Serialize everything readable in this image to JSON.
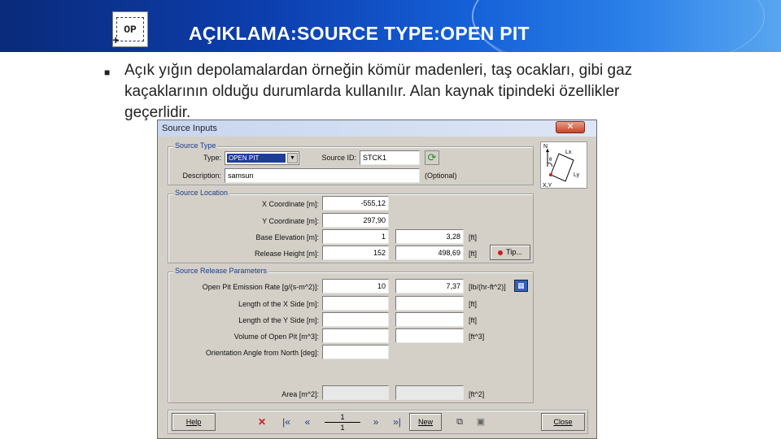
{
  "slide": {
    "title": "AÇIKLAMA:SOURCE TYPE:OPEN PIT",
    "logo_text": "OP",
    "bullet": "Açık yığın depolamalardan örneğin kömür madenleri, taş ocakları, gibi gaz kaçaklarının olduğu durumlarda kullanılır. Alan kaynak tipindeki özellikler geçerlidir."
  },
  "window": {
    "title": "Source Inputs",
    "close_label": "✕",
    "source_type": {
      "group_title": "Source Type",
      "type_label": "Type:",
      "type_value": "OPEN PIT",
      "source_id_label": "Source ID:",
      "source_id_value": "STCK1",
      "description_label": "Description:",
      "description_value": "samsun",
      "optional_label": "(Optional)"
    },
    "source_location": {
      "group_title": "Source Location",
      "x_label": "X Coordinate [m]:",
      "x_value": "-555,12",
      "y_label": "Y Coordinate [m]:",
      "y_value": "297,90",
      "base_label": "Base Elevation [m]:",
      "base_value": "1",
      "base_ft_value": "3,28",
      "base_unit": "[ft]",
      "release_label": "Release Height [m]:",
      "release_value": "152",
      "release_ft_value": "498,69",
      "release_unit": "[ft]",
      "tip_label": "Tip..."
    },
    "release_params": {
      "group_title": "Source Release Parameters",
      "emission_label": "Open Pit Emission Rate [g/(s-m^2)]:",
      "emission_value": "10",
      "emission_alt_value": "7,37",
      "emission_unit": "[lb/(hr-ft^2)]",
      "x_side_label": "Length of the X Side [m]:",
      "x_side_unit": "[ft]",
      "y_side_label": "Length of the Y Side [m]:",
      "y_side_unit": "[ft]",
      "volume_label": "Volume of Open Pit [m^3]:",
      "volume_unit": "[ft^3]",
      "orientation_label": "Orientation Angle from North [deg]:",
      "area_label": "Area [m^2]:",
      "area_unit": "[ft^2]"
    },
    "diagram": {
      "north": "N",
      "lx": "Lx",
      "ly": "Ly",
      "xy": "X,Y",
      "theta": "θ"
    },
    "bottom_bar": {
      "help_label": "Help",
      "page_current": "1",
      "page_total": "1",
      "new_label": "New",
      "close_label": "Close"
    }
  }
}
